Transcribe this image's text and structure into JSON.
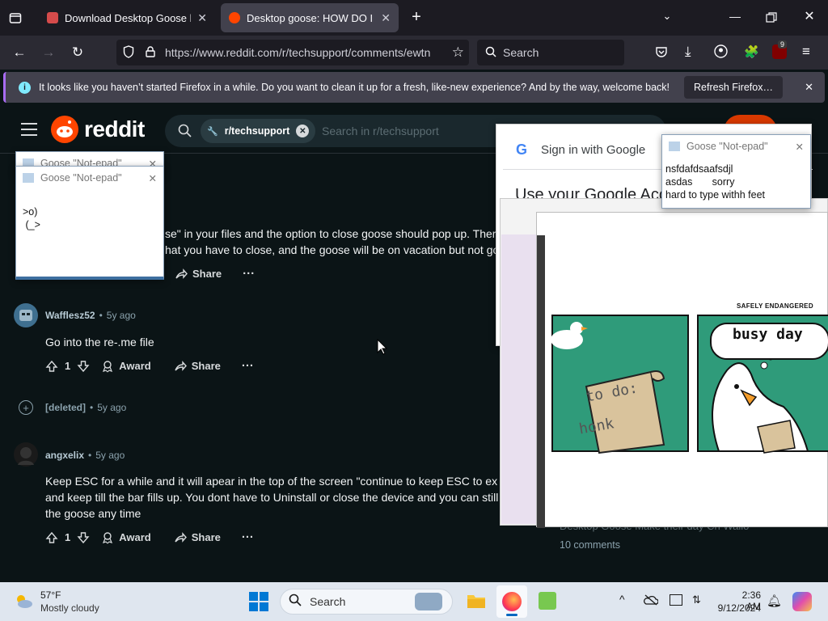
{
  "browser": {
    "tabs": [
      {
        "title": "Download Desktop Goose by sa",
        "active": false
      },
      {
        "title": "Desktop goose: HOW DO I DELE",
        "active": true
      }
    ],
    "url": "https://www.reddit.com/r/techsupport/comments/ewtn",
    "search_placeholder": "Search",
    "extension_badge": "9",
    "notification": "It looks like you haven’t started Firefox in a while. Do you want to clean it up for a fresh, like-new experience? And by the way, welcome back!",
    "refresh_button": "Refresh Firefox…"
  },
  "reddit": {
    "logo_text": "reddit",
    "subreddit_chip": "r/techsupport",
    "search_placeholder": "Search in r/techsupport",
    "partial_comment": {
      "line1": "se\" in your files and the option to close goose should pop up. There",
      "line2": "hat you have to close, and the goose will be on vacation but not go",
      "share": "Share"
    },
    "comments": [
      {
        "user": "Wafflesz52",
        "time": "5y ago",
        "text": "Go into the re-.me file",
        "votes": "1",
        "award": "Award",
        "share": "Share"
      },
      {
        "user": "[deleted]",
        "time": "5y ago"
      },
      {
        "user": "angxelix",
        "time": "5y ago",
        "text1": "Keep ESC for a while and it will apear in the top of the screen \"continue to keep ESC to exit g",
        "text2": "and keep till the bar fills up. You dont have to Uninstall or close the device and you can still a",
        "text3": "the goose any time",
        "votes": "1",
        "award": "Award",
        "share": "Share"
      }
    ],
    "side_partial": "10 comments",
    "side_partial_title": "Desktop Goose Make their day Ch Wallo"
  },
  "google_signin": {
    "title": "Sign in with Google",
    "heading": "Use your Google Acc"
  },
  "notepad_left": {
    "title_back": "Goose \"Not-epad\"",
    "title": "Goose \"Not-epad\"",
    "line1": ">o)",
    "line2": " (_>"
  },
  "notepad_right": {
    "title": "Goose \"Not-epad\"",
    "line1": "nsfdafdsaafsdjl",
    "line2": "asdas       sorry",
    "line3": "hard to type withh feet"
  },
  "meme": {
    "header": "SAFELY ENDANGERED",
    "panel1_text1": "to do:",
    "panel1_text2": "honk",
    "panel2_text": "busy day"
  },
  "taskbar": {
    "temp": "57°F",
    "weather": "Mostly cloudy",
    "search": "Search",
    "time": "2:36 AM",
    "date": "9/12/2024"
  }
}
